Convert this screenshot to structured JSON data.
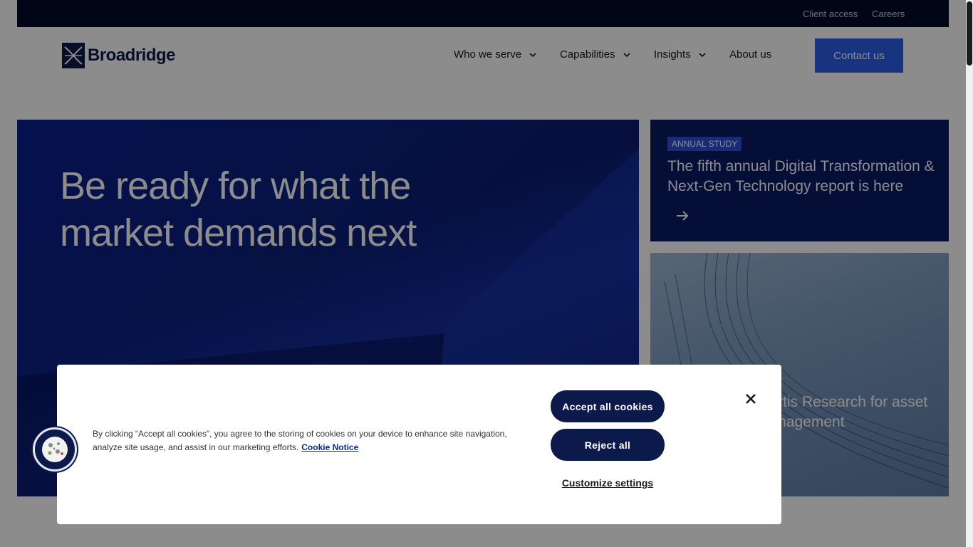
{
  "utility": {
    "client_access": "Client access",
    "careers": "Careers"
  },
  "header": {
    "logo_text": "Broadridge",
    "nav": {
      "who_we_serve": "Who we serve",
      "capabilities": "Capabilities",
      "insights": "Insights",
      "about_us": "About us"
    },
    "contact_label": "Contact us"
  },
  "hero": {
    "title": "Be ready for what the market demands next"
  },
  "side_cards": {
    "top": {
      "badge": "ANNUAL STUDY",
      "title": "The fifth annual Digital Transformation & Next-Gen Technology report is here",
      "icon": "arrow-right-icon"
    },
    "bottom": {
      "title": "martis Research for asset management"
    }
  },
  "cookie_banner": {
    "text": "By clicking “Accept all cookies”, you agree to the storing of cookies on your device to enhance site navigation, analyze site usage, and assist in our marketing efforts.",
    "notice_link": "Cookie Notice",
    "accept_label": "Accept all cookies",
    "reject_label": "Reject all",
    "customize_label": "Customize settings",
    "close_icon": "close-icon",
    "fab_icon": "cookie-icon"
  },
  "colors": {
    "navy": "#0b1a4a",
    "accent_blue": "#2f5fe5",
    "utility_bg": "#030b2b"
  }
}
